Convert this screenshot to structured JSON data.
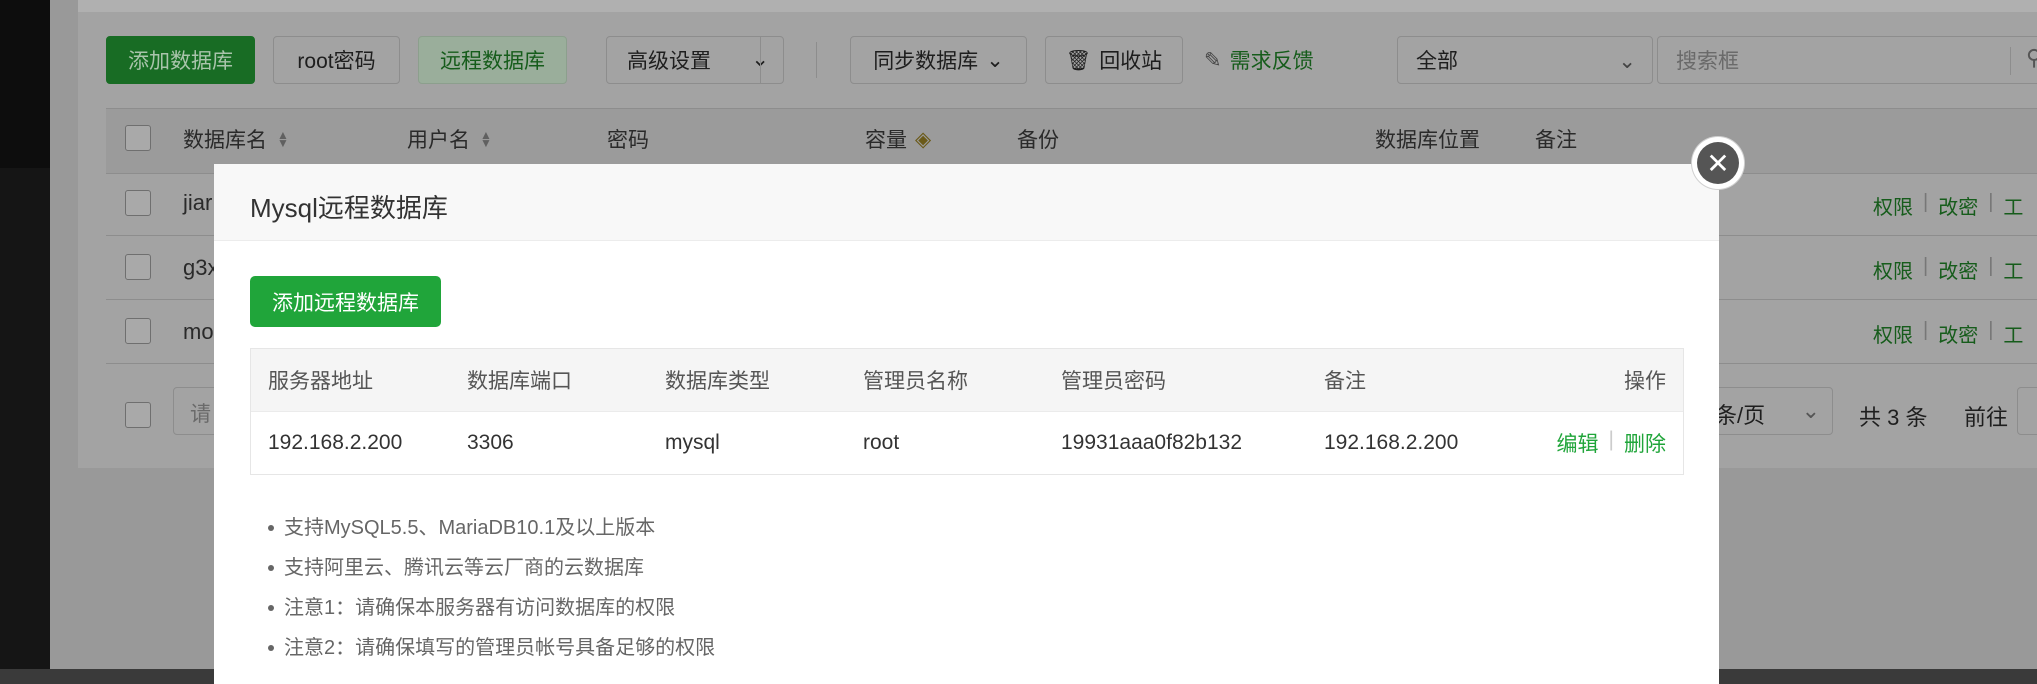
{
  "toolbar": {
    "add_db": "添加数据库",
    "root_pwd": "root密码",
    "remote_db": "远程数据库",
    "advanced": "高级设置",
    "sync_db": "同步数据库",
    "recycle": "回收站",
    "feedback": "需求反馈",
    "filter_value": "全部",
    "search_placeholder": "搜索框"
  },
  "table": {
    "headers": {
      "name": "数据库名",
      "user": "用户名",
      "password": "密码",
      "capacity": "容量",
      "backup": "备份",
      "location": "数据库位置",
      "remark": "备注"
    },
    "rows": [
      {
        "name": "jiar"
      },
      {
        "name": "g3x"
      },
      {
        "name": "mo"
      }
    ],
    "row_ops": {
      "perm": "权限",
      "pwd": "改密",
      "tools": "工"
    }
  },
  "pager": {
    "input_placeholder": "请",
    "page_size": "条/页",
    "total": "共 3 条",
    "goto": "前往"
  },
  "modal": {
    "title": "Mysql远程数据库",
    "add_button": "添加远程数据库",
    "columns": [
      "服务器地址",
      "数据库端口",
      "数据库类型",
      "管理员名称",
      "管理员密码",
      "备注",
      "操作"
    ],
    "rows": [
      {
        "host": "192.168.2.200",
        "port": "3306",
        "type": "mysql",
        "admin": "root",
        "password": "19931aaa0f82b132",
        "remark": "192.168.2.200",
        "edit": "编辑",
        "delete": "删除"
      }
    ],
    "notes": [
      "支持MySQL5.5、MariaDB10.1及以上版本",
      "支持阿里云、腾讯云等云厂商的云数据库",
      "注意1：请确保本服务器有访问数据库的权限",
      "注意2：请确保填写的管理员帐号具备足够的权限"
    ]
  },
  "colors": {
    "accent": "#20a53a",
    "overlay_dark_green": "#186c24"
  }
}
